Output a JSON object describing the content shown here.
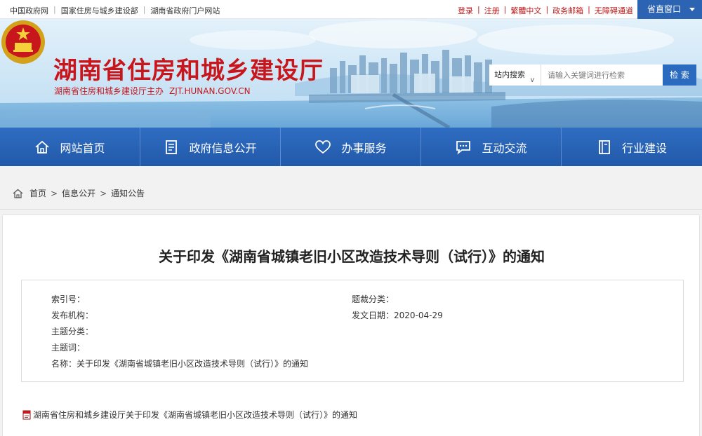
{
  "topbar": {
    "links": [
      "中国政府网",
      "国家住房与城乡建设部",
      "湖南省政府门户网站"
    ],
    "user_links": [
      "登录",
      "注册",
      "繁體中文",
      "政务邮箱",
      "无障碍通道"
    ],
    "province_window": "省直窗口"
  },
  "header": {
    "title": "湖南省住房和城乡建设厅",
    "subtitle": "湖南省住房和城乡建设厅主办",
    "domain": "ZJT.HUNAN.GOV.CN"
  },
  "search": {
    "scope": "站内搜索",
    "placeholder": "请输入关键词进行检索",
    "button": "检 索"
  },
  "nav": {
    "items": [
      {
        "label": "网站首页",
        "icon": "home-icon"
      },
      {
        "label": "政府信息公开",
        "icon": "document-icon"
      },
      {
        "label": "办事服务",
        "icon": "heart-icon"
      },
      {
        "label": "互动交流",
        "icon": "chat-icon"
      },
      {
        "label": "行业建设",
        "icon": "book-icon"
      }
    ]
  },
  "breadcrumb": {
    "items": [
      "首页",
      "信息公开",
      "通知公告"
    ],
    "separator": ">"
  },
  "article": {
    "title": "关于印发《湖南省城镇老旧小区改造技术导则（试行）》的通知",
    "meta": {
      "index_label": "索引号：",
      "index_value": "",
      "genre_label": "题裁分类：",
      "genre_value": "",
      "publisher_label": "发布机构：",
      "publisher_value": "",
      "date_label": "发文日期：",
      "date_value": "2020-04-29",
      "topic_label": "主题分类：",
      "topic_value": "",
      "keywords_label": "主题词：",
      "keywords_value": "",
      "name_label": "名称：",
      "name_value": "关于印发《湖南省城镇老旧小区改造技术导则（试行）》的通知"
    },
    "attachment": "湖南省住房和城乡建设厅关于印发《湖南省城镇老旧小区改造技术导则（试行）》的通知"
  },
  "colors": {
    "brand_red": "#c8161d",
    "nav_blue": "#2662b6",
    "search_blue": "#2a6bbf"
  }
}
